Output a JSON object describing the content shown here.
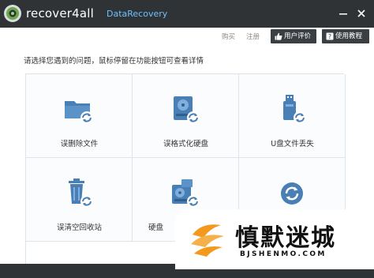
{
  "titlebar": {
    "app_name": "recover4all",
    "app_subtitle": "DataRecovery",
    "minimize_glyph": "—",
    "close_glyph": "✕"
  },
  "toolbar": {
    "buy_label": "购买",
    "register_label": "注册",
    "review_label": "用户评价",
    "tutorial_label": "使用教程"
  },
  "main": {
    "prompt": "请选择您遇到的问题，鼠标停留在功能按钮可查看详情",
    "options": [
      {
        "label": "误删除文件",
        "icon": "folder-recover-icon"
      },
      {
        "label": "误格式化硬盘",
        "icon": "hard-drive-recover-icon"
      },
      {
        "label": "U盘文件丢失",
        "icon": "usb-drive-recover-icon"
      },
      {
        "label": "误清空回收站",
        "icon": "recycle-bin-recover-icon"
      },
      {
        "label": "硬盘",
        "icon": "disk-recover-icon"
      },
      {
        "label": "",
        "icon": "refresh-icon"
      }
    ]
  },
  "watermark": {
    "title": "慎默迷城",
    "domain": "BJSHENMO.COM"
  },
  "colors": {
    "titlebar_bg": "#2f3336",
    "accent_blue": "#4a7fb5",
    "subtitle_blue": "#6ec1ff",
    "grid_border": "#dfe4ea",
    "watermark_orange": "#f39a1e"
  }
}
